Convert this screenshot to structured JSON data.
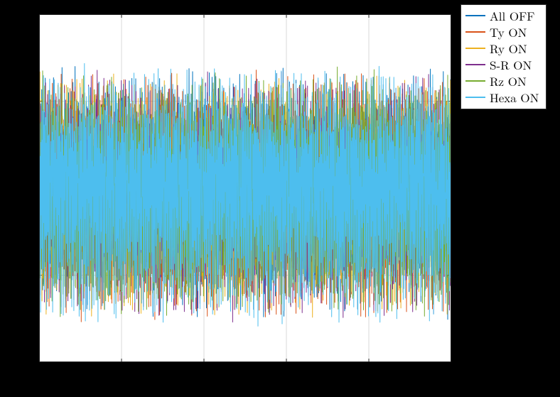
{
  "chart_data": {
    "type": "line",
    "title": "",
    "xlabel": "",
    "ylabel": "",
    "xlim": [
      0,
      5
    ],
    "ylim": [
      -0.5,
      0.5
    ],
    "xticks": [
      0,
      1,
      2,
      3,
      4,
      5
    ],
    "yticks": [
      -0.5,
      -0.25,
      0,
      0.25,
      0.5
    ],
    "note": "Dense noise time-series; six overlapping series with amplitude roughly ±0.3–0.4. Values below are representative samples drawn from each visible trace at evenly spaced x positions (x_start=0, x_step=0.04, 125 points). Exact per-pixel values are not recoverable from the raster.",
    "x_start": 0,
    "x_step": 0.04,
    "n_points": 125,
    "series": [
      {
        "name": "All OFF",
        "color": "#0072BD",
        "values": [
          0.02,
          -0.11,
          0.24,
          -0.18,
          0.07,
          0.19,
          -0.22,
          0.05,
          -0.14,
          0.28,
          -0.09,
          0.12,
          -0.31,
          0.17,
          0.03,
          -0.25,
          0.21,
          -0.06,
          0.14,
          -0.19,
          0.08,
          0.26,
          -0.13,
          0.04,
          -0.27,
          0.16,
          -0.02,
          0.22,
          -0.15,
          0.09,
          -0.24,
          0.18,
          0.01,
          -0.12,
          0.27,
          -0.08,
          0.13,
          -0.29,
          0.19,
          -0.04,
          0.11,
          -0.21,
          0.06,
          0.23,
          -0.17,
          0.02,
          -0.26,
          0.15,
          -0.01,
          0.24,
          -0.14,
          0.08,
          -0.23,
          0.17,
          0.04,
          -0.11,
          0.28,
          -0.07,
          0.12,
          -0.31,
          0.18,
          -0.03,
          0.1,
          -0.22,
          0.07,
          0.25,
          -0.16,
          0.01,
          -0.27,
          0.14,
          -0.02,
          0.23,
          -0.13,
          0.09,
          -0.24,
          0.16,
          0.03,
          -0.12,
          0.27,
          -0.08,
          0.11,
          -0.29,
          0.19,
          -0.04,
          0.1,
          -0.21,
          0.06,
          0.24,
          -0.17,
          0.02,
          -0.25,
          0.15,
          -0.01,
          0.22,
          -0.14,
          0.08,
          -0.23,
          0.18,
          0.04,
          -0.11,
          0.26,
          -0.07,
          0.13,
          -0.28,
          0.17,
          -0.03,
          0.1,
          -0.22,
          0.07,
          0.25,
          -0.16,
          0.01,
          -0.27,
          0.14,
          -0.02,
          0.23,
          -0.13,
          0.09,
          -0.24,
          0.16,
          0.03,
          -0.12,
          0.27,
          -0.08,
          0.11
        ]
      },
      {
        "name": "Ty ON",
        "color": "#D95319",
        "values": [
          -0.08,
          0.21,
          -0.13,
          0.05,
          -0.26,
          0.17,
          0.02,
          -0.19,
          0.24,
          -0.07,
          0.11,
          -0.28,
          0.16,
          0.03,
          -0.22,
          0.19,
          -0.05,
          0.13,
          -0.31,
          0.08,
          0.25,
          -0.14,
          0.01,
          -0.23,
          0.18,
          -0.02,
          0.12,
          -0.27,
          0.15,
          0.04,
          -0.21,
          0.22,
          -0.06,
          0.1,
          -0.29,
          0.17,
          0.02,
          -0.18,
          0.26,
          -0.09,
          0.11,
          -0.24,
          0.14,
          0.03,
          -0.2,
          0.23,
          -0.04,
          0.12,
          -0.28,
          0.16,
          0.01,
          -0.22,
          0.19,
          -0.07,
          0.13,
          -0.3,
          0.09,
          0.25,
          -0.15,
          0.02,
          -0.23,
          0.18,
          -0.01,
          0.11,
          -0.26,
          0.15,
          0.04,
          -0.21,
          0.22,
          -0.06,
          0.1,
          -0.29,
          0.17,
          0.02,
          -0.18,
          0.26,
          -0.09,
          0.11,
          -0.24,
          0.14,
          0.03,
          -0.2,
          0.23,
          -0.04,
          0.12,
          -0.28,
          0.16,
          0.01,
          -0.22,
          0.19,
          -0.07,
          0.13,
          -0.3,
          0.09,
          0.25,
          -0.15,
          0.02,
          -0.23,
          0.18,
          -0.01,
          0.11,
          -0.26,
          0.15,
          0.04,
          -0.21,
          0.22,
          -0.06,
          0.1,
          -0.29,
          0.17,
          0.02,
          -0.18,
          0.26,
          -0.09,
          0.11,
          -0.24,
          0.14,
          0.03,
          -0.2,
          0.23,
          -0.04,
          0.12,
          -0.28,
          0.16,
          0.01
        ]
      },
      {
        "name": "Ry ON",
        "color": "#EDB120",
        "values": [
          0.14,
          -0.22,
          0.06,
          0.27,
          -0.11,
          0.03,
          -0.24,
          0.18,
          -0.02,
          0.12,
          -0.29,
          0.15,
          0.04,
          -0.2,
          0.23,
          -0.07,
          0.1,
          -0.26,
          0.17,
          0.01,
          -0.18,
          0.25,
          -0.09,
          0.11,
          -0.31,
          0.19,
          -0.03,
          0.13,
          -0.22,
          0.08,
          0.24,
          -0.14,
          0.02,
          -0.27,
          0.16,
          -0.01,
          0.21,
          -0.12,
          0.05,
          -0.28,
          0.17,
          0.04,
          -0.19,
          0.23,
          -0.06,
          0.1,
          -0.25,
          0.18,
          0.02,
          -0.17,
          0.26,
          -0.08,
          0.12,
          -0.3,
          0.15,
          0.03,
          -0.21,
          0.22,
          -0.05,
          0.11,
          -0.27,
          0.16,
          0.01,
          -0.18,
          0.24,
          -0.09,
          0.1,
          -0.29,
          0.19,
          -0.03,
          0.13,
          -0.22,
          0.07,
          0.25,
          -0.14,
          0.02,
          -0.26,
          0.16,
          -0.01,
          0.21,
          -0.12,
          0.05,
          -0.28,
          0.17,
          0.04,
          -0.19,
          0.23,
          -0.06,
          0.1,
          -0.25,
          0.18,
          0.02,
          -0.17,
          0.26,
          -0.08,
          0.12,
          -0.3,
          0.15,
          0.03,
          -0.21,
          0.22,
          -0.05,
          0.11,
          -0.27,
          0.16,
          0.01,
          -0.18,
          0.24,
          -0.09,
          0.1,
          -0.29,
          0.19,
          -0.03,
          0.13,
          -0.22,
          0.07,
          0.25,
          -0.14,
          0.02,
          -0.26,
          0.16,
          -0.01,
          0.21,
          -0.12,
          0.05
        ]
      },
      {
        "name": "S-R ON",
        "color": "#7E2F8E",
        "values": [
          -0.19,
          0.07,
          0.24,
          -0.12,
          0.03,
          -0.27,
          0.16,
          -0.01,
          0.21,
          -0.15,
          0.09,
          -0.28,
          0.18,
          0.02,
          -0.22,
          0.25,
          -0.06,
          0.11,
          -0.3,
          0.14,
          0.04,
          -0.2,
          0.23,
          -0.08,
          0.1,
          -0.26,
          0.17,
          0.01,
          -0.18,
          0.26,
          -0.09,
          0.12,
          -0.31,
          0.15,
          0.03,
          -0.21,
          0.22,
          -0.05,
          0.11,
          -0.27,
          0.16,
          0.01,
          -0.18,
          0.24,
          -0.09,
          0.1,
          -0.29,
          0.19,
          -0.03,
          0.13,
          -0.22,
          0.07,
          0.25,
          -0.14,
          0.02,
          -0.26,
          0.16,
          -0.01,
          0.21,
          -0.12,
          0.05,
          -0.28,
          0.17,
          0.04,
          -0.19,
          0.23,
          -0.06,
          0.1,
          -0.25,
          0.18,
          0.02,
          -0.17,
          0.26,
          -0.08,
          0.12,
          -0.3,
          0.15,
          0.03,
          -0.21,
          0.22,
          -0.05,
          0.11,
          -0.27,
          0.16,
          0.01,
          -0.18,
          0.24,
          -0.09,
          0.1,
          -0.29,
          0.19,
          -0.03,
          0.13,
          -0.22,
          0.07,
          0.25,
          -0.14,
          0.02,
          -0.26,
          0.16,
          -0.01,
          0.21,
          -0.12,
          0.05,
          -0.28,
          0.17,
          0.04,
          -0.19,
          0.23,
          -0.06,
          0.1,
          -0.25,
          0.18,
          0.02,
          -0.17,
          0.26,
          -0.08,
          0.12,
          -0.3,
          0.15,
          0.03,
          -0.21,
          0.22,
          -0.05,
          0.11
        ]
      },
      {
        "name": "Rz ON",
        "color": "#77AC30",
        "values": [
          0.11,
          -0.28,
          0.16,
          0.03,
          -0.21,
          0.24,
          -0.07,
          0.1,
          -0.26,
          0.18,
          0.01,
          -0.19,
          0.27,
          -0.09,
          0.12,
          -0.31,
          0.15,
          0.04,
          -0.2,
          0.23,
          -0.05,
          0.11,
          -0.27,
          0.16,
          0.02,
          -0.18,
          0.25,
          -0.08,
          0.1,
          -0.29,
          0.19,
          -0.03,
          0.13,
          -0.22,
          0.07,
          0.26,
          -0.14,
          0.02,
          -0.26,
          0.16,
          -0.01,
          0.21,
          -0.12,
          0.05,
          -0.28,
          0.17,
          0.04,
          -0.19,
          0.23,
          -0.06,
          0.1,
          -0.25,
          0.18,
          0.02,
          -0.17,
          0.26,
          -0.08,
          0.12,
          -0.3,
          0.15,
          0.03,
          -0.21,
          0.22,
          -0.05,
          0.11,
          -0.27,
          0.16,
          0.01,
          -0.18,
          0.24,
          -0.09,
          0.1,
          -0.29,
          0.19,
          -0.03,
          0.13,
          -0.22,
          0.07,
          0.25,
          -0.14,
          0.02,
          -0.26,
          0.16,
          -0.01,
          0.21,
          -0.12,
          0.05,
          -0.28,
          0.17,
          0.04,
          -0.19,
          0.23,
          -0.06,
          0.1,
          -0.25,
          0.18,
          0.02,
          -0.17,
          0.26,
          -0.08,
          0.12,
          -0.3,
          0.15,
          0.03,
          -0.21,
          0.22,
          -0.05,
          0.11,
          -0.27,
          0.16,
          0.01,
          -0.18,
          0.24,
          -0.09,
          0.1,
          -0.29,
          0.19,
          -0.03,
          0.13,
          -0.22,
          0.07,
          0.25,
          -0.14,
          0.02,
          -0.26
        ]
      },
      {
        "name": "Hexa ON",
        "color": "#4DBEEE",
        "values": [
          -0.22,
          0.09,
          0.26,
          -0.13,
          0.04,
          -0.29,
          0.17,
          -0.02,
          0.22,
          -0.16,
          0.1,
          -0.3,
          0.19,
          0.03,
          -0.23,
          0.27,
          -0.07,
          0.12,
          -0.32,
          0.15,
          0.05,
          -0.21,
          0.25,
          -0.09,
          0.11,
          -0.28,
          0.18,
          0.02,
          -0.19,
          0.28,
          -0.1,
          0.13,
          -0.33,
          0.16,
          0.04,
          -0.22,
          0.24,
          -0.06,
          0.12,
          -0.29,
          0.17,
          0.02,
          -0.19,
          0.26,
          -0.1,
          0.11,
          -0.31,
          0.2,
          -0.03,
          0.14,
          -0.23,
          0.08,
          0.27,
          -0.15,
          0.03,
          -0.28,
          0.17,
          -0.01,
          0.23,
          -0.13,
          0.06,
          -0.3,
          0.18,
          0.05,
          -0.2,
          0.25,
          -0.07,
          0.11,
          -0.27,
          0.19,
          0.03,
          -0.18,
          0.28,
          -0.09,
          0.13,
          -0.32,
          0.16,
          0.04,
          -0.22,
          0.24,
          -0.06,
          0.12,
          -0.29,
          0.17,
          0.02,
          -0.19,
          0.26,
          -0.1,
          0.11,
          -0.31,
          0.2,
          -0.03,
          0.14,
          -0.23,
          0.08,
          0.27,
          -0.15,
          0.03,
          -0.28,
          0.17,
          -0.01,
          0.23,
          -0.13,
          0.06,
          -0.3,
          0.18,
          0.05,
          -0.2,
          0.25,
          -0.07,
          0.11,
          -0.27,
          0.19,
          0.03,
          -0.18,
          0.28,
          -0.09,
          0.13,
          -0.32,
          0.16,
          0.04,
          -0.22,
          0.24,
          -0.06,
          0.12
        ]
      }
    ],
    "legend_entries": [
      "All OFF",
      "Ty ON",
      "Ry ON",
      "S-R ON",
      "Rz ON",
      "Hexa ON"
    ]
  }
}
